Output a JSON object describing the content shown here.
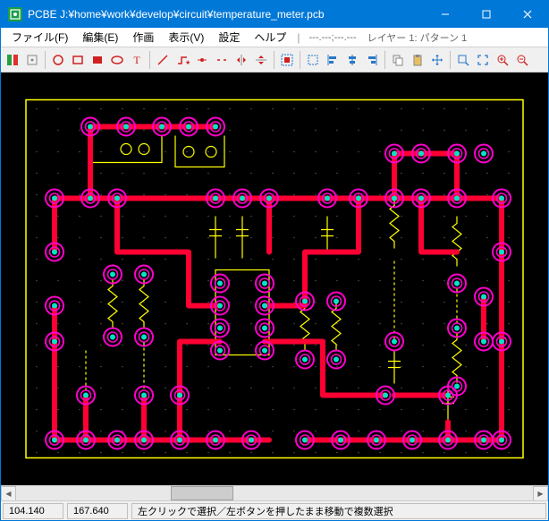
{
  "title": "PCBE  J:¥home¥work¥develop¥circuit¥temperature_meter.pcb",
  "menu": {
    "file": "ファイル(F)",
    "edit": "編集(E)",
    "draw": "作画",
    "show": "表示(V)",
    "settings": "設定",
    "help": "ヘルプ",
    "coords_hint": "---.---;---.---",
    "layer": "レイヤー 1: パターン 1"
  },
  "status": {
    "x": "104.140",
    "y": "167.640",
    "msg": "左クリックで選択／左ボタンを押したまま移動で複数選択"
  },
  "toolbar_icons": [
    "layers-icon",
    "snap-icon",
    "sep",
    "circle-icon",
    "rect-icon",
    "rect-fill-icon",
    "oval-icon",
    "text-icon",
    "sep",
    "line-icon",
    "route-icon",
    "node-icon",
    "trim-icon",
    "flip-h-icon",
    "flip-v-icon",
    "sep",
    "group-icon",
    "sep",
    "select-icon",
    "align-l-icon",
    "align-c-icon",
    "align-r-icon",
    "sep",
    "copy-icon",
    "paste-icon",
    "move-icon",
    "sep",
    "zoom-window-icon",
    "zoom-fit-icon",
    "zoom-in-icon",
    "zoom-out-icon"
  ],
  "colors": {
    "titlebar": "#0078d7",
    "pcb_bg": "#000000",
    "outline": "#ffff00",
    "trace": "#ff0033",
    "pad_outer": "#ff00cc",
    "pad_inner": "#00ffd0"
  }
}
